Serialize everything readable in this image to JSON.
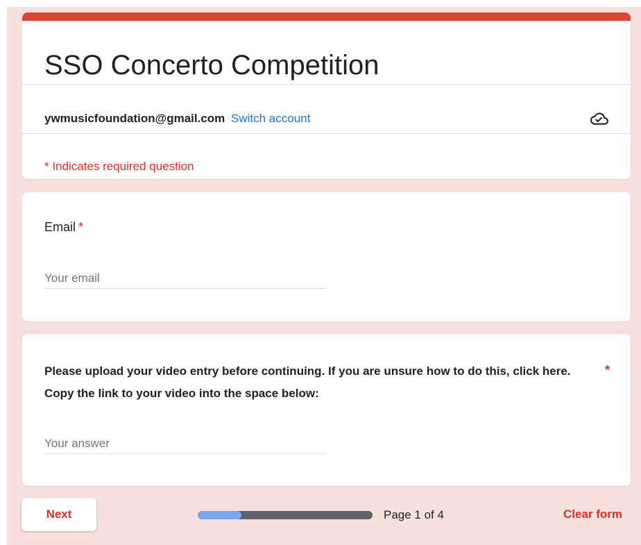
{
  "form": {
    "title": "SSO Concerto Competition",
    "account_email": "ywmusicfoundation@gmail.com",
    "switch_account_label": "Switch account",
    "required_note": "* Indicates required question",
    "cloud_icon": "cloud-done-icon"
  },
  "questions": [
    {
      "label": "Email",
      "required_marker": "*",
      "placeholder": "Your email",
      "value": ""
    },
    {
      "label": "Please upload your video entry before continuing. If you are unsure how to do this, click here. Copy the link to your video into the space below:",
      "required_marker": "*",
      "placeholder": "Your answer",
      "value": ""
    }
  ],
  "footer": {
    "next_label": "Next",
    "page_indicator": "Page 1 of 4",
    "progress_fraction": 0.25,
    "clear_form_label": "Clear form"
  },
  "colors": {
    "accent": "#db4437",
    "page_background": "#f8e1dd",
    "link": "#1a73e8",
    "required": "#d93025",
    "progress_fill": "#7aa7f0",
    "progress_track": "#5f6368"
  }
}
